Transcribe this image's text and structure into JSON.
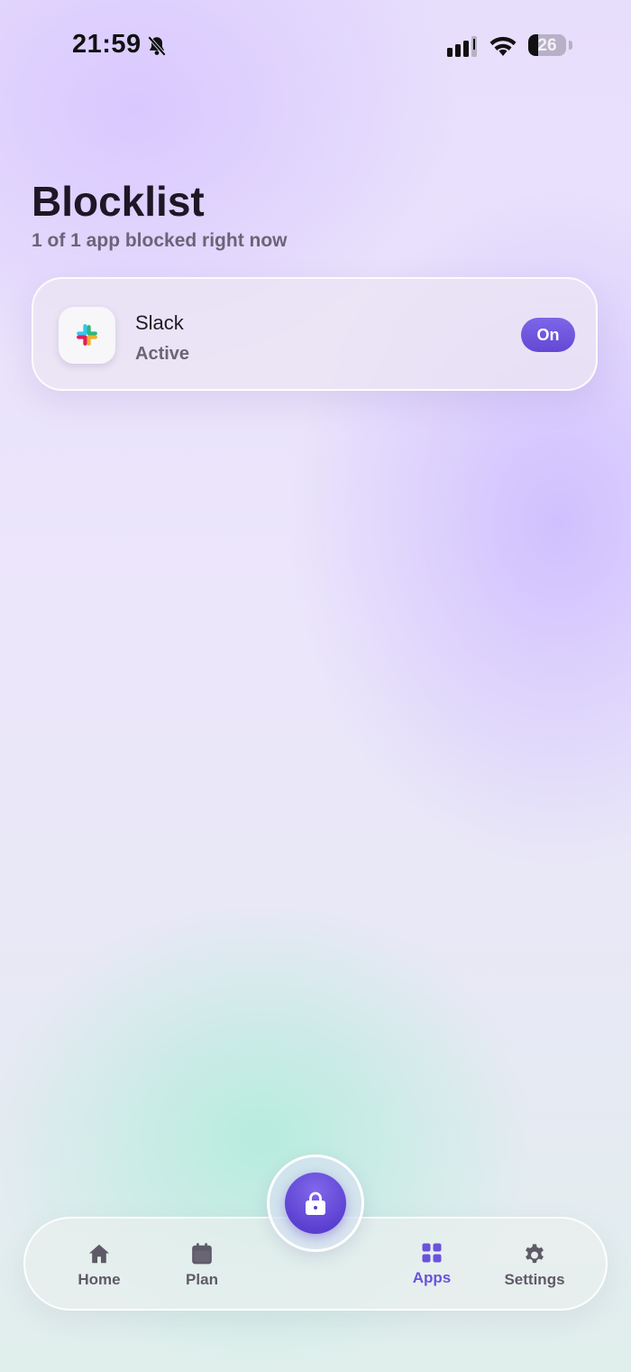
{
  "status_bar": {
    "time": "21:59",
    "battery": "26",
    "icons": [
      "bell-slash-icon",
      "cellular-signal-icon",
      "wifi-icon",
      "battery-icon"
    ]
  },
  "header": {
    "title": "Blocklist",
    "subtitle": "1 of 1 app blocked right now"
  },
  "apps": [
    {
      "name": "Slack",
      "status": "Active",
      "toggle_label": "On",
      "icon": "slack-logo"
    }
  ],
  "tab_bar": {
    "tabs": [
      {
        "label": "Home",
        "icon": "house-icon"
      },
      {
        "label": "Plan",
        "icon": "calendar-icon"
      },
      {
        "label": "Apps",
        "icon": "grid-icon",
        "active": true
      },
      {
        "label": "Settings",
        "icon": "gear-icon"
      }
    ],
    "center_button_icon": "lock-icon"
  },
  "colors": {
    "accent": "#6a52dc",
    "text": "#1d1726",
    "muted": "#6b6478"
  }
}
